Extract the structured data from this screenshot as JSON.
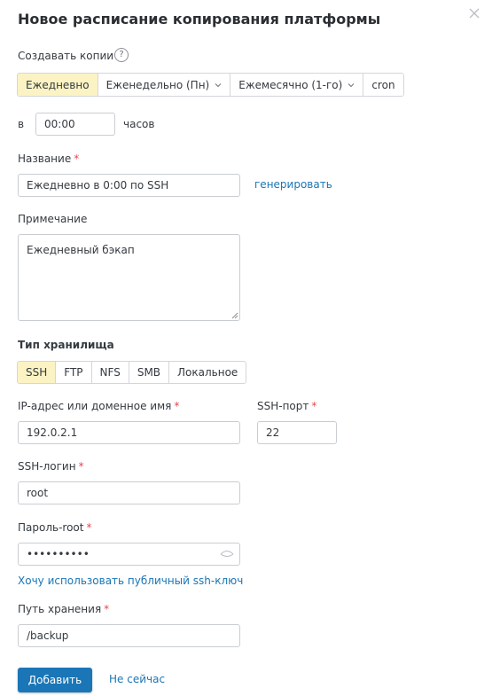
{
  "dialog": {
    "title": "Новое расписание копирования платформы"
  },
  "schedule": {
    "label": "Создавать копии",
    "help": "?",
    "options": [
      {
        "label": "Ежедневно",
        "active": true,
        "dropdown": false
      },
      {
        "label": "Еженедельно (Пн)",
        "active": false,
        "dropdown": true
      },
      {
        "label": "Ежемесячно (1-го)",
        "active": false,
        "dropdown": true
      },
      {
        "label": "cron",
        "active": false,
        "dropdown": false
      }
    ],
    "at_label": "в",
    "time_value": "00:00",
    "hours_label": "часов"
  },
  "name_field": {
    "label": "Название",
    "required": "*",
    "value": "Ежедневно в 0:00 по SSH",
    "generate_link": "генерировать"
  },
  "note_field": {
    "label": "Примечание",
    "value": "Ежедневный бэкап"
  },
  "storage": {
    "label": "Тип хранилища",
    "options": [
      {
        "label": "SSH",
        "active": true
      },
      {
        "label": "FTP",
        "active": false
      },
      {
        "label": "NFS",
        "active": false
      },
      {
        "label": "SMB",
        "active": false
      },
      {
        "label": "Локальное",
        "active": false
      }
    ]
  },
  "host_field": {
    "label": "IP-адрес или доменное имя",
    "required": "*",
    "value": "192.0.2.1"
  },
  "port_field": {
    "label": "SSH-порт",
    "required": "*",
    "value": "22"
  },
  "login_field": {
    "label": "SSH-логин",
    "required": "*",
    "value": "root"
  },
  "password_field": {
    "label": "Пароль-root",
    "required": "*",
    "value": "••••••••••"
  },
  "ssh_key_link": "Хочу использовать публичный ssh-ключ",
  "path_field": {
    "label": "Путь хранения",
    "required": "*",
    "value": "/backup"
  },
  "actions": {
    "submit": "Добавить",
    "cancel": "Не сейчас"
  },
  "colors": {
    "accent": "#1a76b6",
    "active_segment": "#fcf3c4",
    "required": "#e5484d"
  }
}
